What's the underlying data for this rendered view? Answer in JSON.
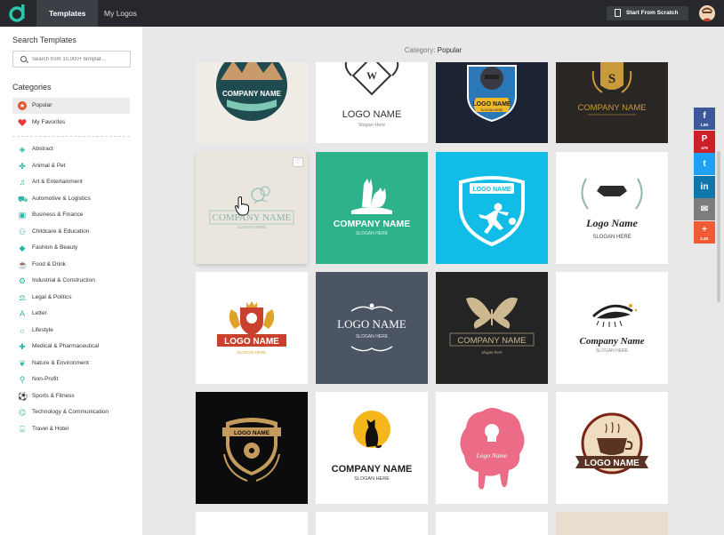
{
  "header": {
    "tabs": [
      {
        "label": "Templates"
      },
      {
        "label": "My Logos"
      }
    ],
    "start_button_label": "Start From Scratch"
  },
  "sidebar": {
    "search_title": "Search Templates",
    "search_placeholder": "Search from 10,000+ templat...",
    "categories_title": "Categories",
    "pinned": [
      {
        "label": "Popular",
        "icon": "star-icon",
        "color": "#e8552a"
      },
      {
        "label": "My Favorites",
        "icon": "heart-icon",
        "color": "#e83a3a"
      }
    ],
    "categories": [
      {
        "label": "Abstract",
        "icon": "abstract-icon"
      },
      {
        "label": "Animal & Pet",
        "icon": "paw-icon"
      },
      {
        "label": "Art & Entertainment",
        "icon": "music-icon"
      },
      {
        "label": "Automotive & Logistics",
        "icon": "car-icon"
      },
      {
        "label": "Business & Finance",
        "icon": "briefcase-icon"
      },
      {
        "label": "Childcare & Education",
        "icon": "education-icon"
      },
      {
        "label": "Fashion & Beauty",
        "icon": "diamond-icon"
      },
      {
        "label": "Food & Drink",
        "icon": "food-icon"
      },
      {
        "label": "Industrial & Construction",
        "icon": "industry-icon"
      },
      {
        "label": "Legal & Politics",
        "icon": "scales-icon"
      },
      {
        "label": "Letter",
        "icon": "letter-icon"
      },
      {
        "label": "Lifestyle",
        "icon": "lifestyle-icon"
      },
      {
        "label": "Medical & Pharmaceutical",
        "icon": "medical-icon"
      },
      {
        "label": "Nature & Environment",
        "icon": "leaf-icon"
      },
      {
        "label": "Non-Profit",
        "icon": "ribbon-icon"
      },
      {
        "label": "Sports & Fitness",
        "icon": "ball-icon"
      },
      {
        "label": "Technology & Communication",
        "icon": "chip-icon"
      },
      {
        "label": "Travel & Hotel",
        "icon": "luggage-icon"
      }
    ]
  },
  "main": {
    "category_prefix": "Category:",
    "category_name": "Popular",
    "templates": [
      {
        "line1": "COMPANY NAME",
        "line2": ""
      },
      {
        "line1": "W",
        "line2": "LOGO NAME",
        "line3": "Slogan Here"
      },
      {
        "line1": "LOGO NAME",
        "line2": "SLOGAN HERE"
      },
      {
        "line1": "S",
        "line2": "COMPANY NAME"
      },
      {
        "line1": "COMPANY NAME",
        "line2": "SLOGAN HERE"
      },
      {
        "line1": "COMPANY NAME",
        "line2": "SLOGAN HERE"
      },
      {
        "line1": "LOGO NAME",
        "line2": ""
      },
      {
        "line1": "Logo Name",
        "line2": "SLOGAN HERE"
      },
      {
        "line1": "LOGO NAME",
        "line2": "SLOGAN HERE"
      },
      {
        "line1": "LOGO NAME",
        "line2": "SLOGAN HERE"
      },
      {
        "line1": "COMPANY NAME",
        "line2": "slogan here"
      },
      {
        "line1": "Company Name",
        "line2": "SLOGAN HERE"
      },
      {
        "line1": "LOGO NAME",
        "line2": ""
      },
      {
        "line1": "COMPANY NAME",
        "line2": "SLOGAN HERE"
      },
      {
        "line1": "Logo Name",
        "line2": ""
      },
      {
        "line1": "LOGO NAME",
        "line2": ""
      }
    ]
  },
  "social": [
    {
      "icon": "facebook-icon",
      "glyph": "f",
      "count": "1.8K",
      "color": "#3b5998"
    },
    {
      "icon": "pinterest-icon",
      "glyph": "P",
      "count": "479",
      "color": "#cb2027"
    },
    {
      "icon": "twitter-icon",
      "glyph": "t",
      "count": "",
      "color": "#1da1f2"
    },
    {
      "icon": "linkedin-icon",
      "glyph": "in",
      "count": "",
      "color": "#0e76a8"
    },
    {
      "icon": "email-icon",
      "glyph": "✉",
      "count": "",
      "color": "#7d7d7d"
    },
    {
      "icon": "share-plus-icon",
      "glyph": "+",
      "count": "2.4K",
      "color": "#f05a35"
    }
  ]
}
